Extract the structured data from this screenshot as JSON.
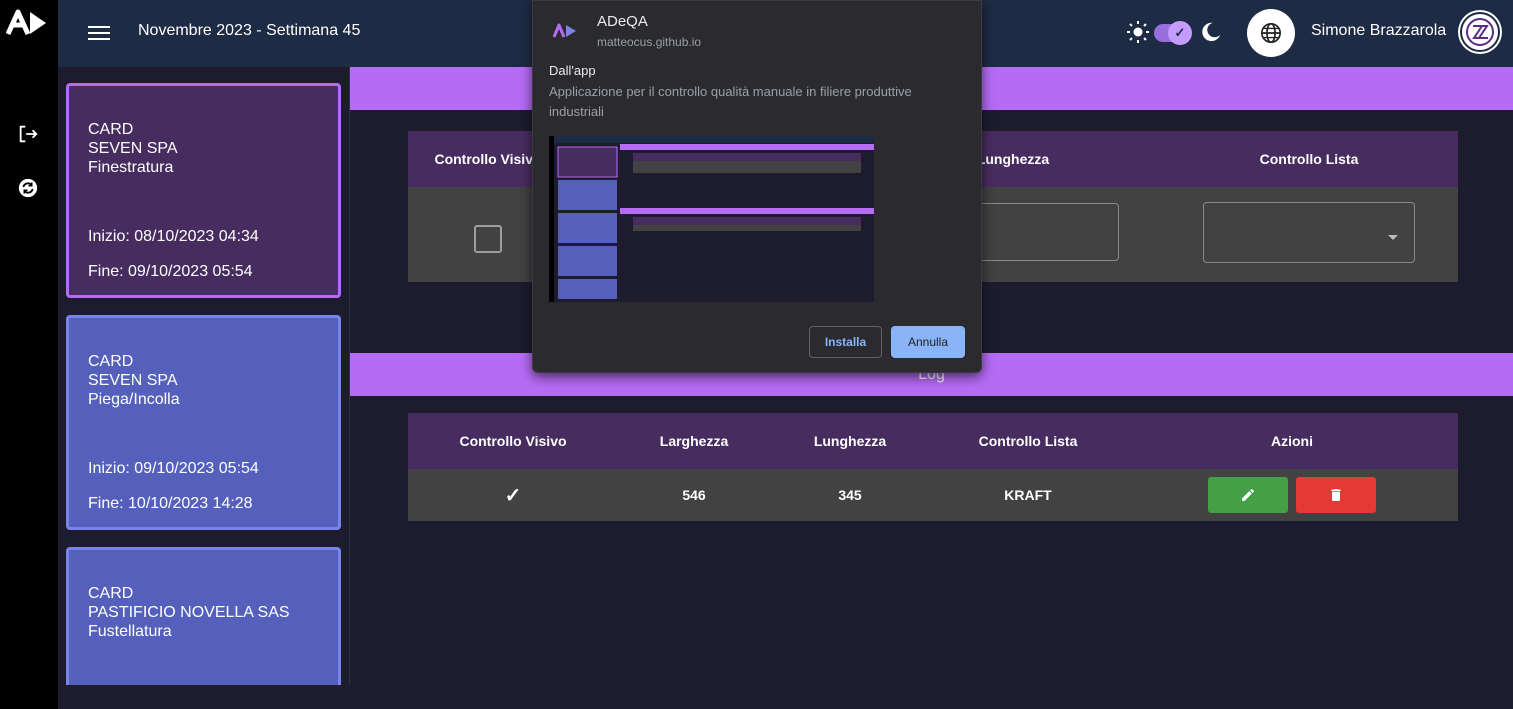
{
  "topbar": {
    "title": "Novembre 2023 - Settimana 45",
    "user_name": "Simone Brazzarola"
  },
  "cards": [
    {
      "line1": "CARD",
      "line2": "SEVEN SPA",
      "line3": "Finestratura",
      "start": "Inizio: 08/10/2023 04:34",
      "end": "Fine: 09/10/2023 05:54",
      "active": true
    },
    {
      "line1": "CARD",
      "line2": "SEVEN SPA",
      "line3": "Piega/Incolla",
      "start": "Inizio: 09/10/2023 05:54",
      "end": "Fine: 10/10/2023 14:28",
      "active": false
    },
    {
      "line1": "CARD",
      "line2": "PASTIFICIO NOVELLA SAS",
      "line3": "Fustellatura",
      "active": false
    }
  ],
  "input_table": {
    "headers": [
      "Controllo Visivo",
      "Lunghezza",
      "Controllo Lista"
    ]
  },
  "log": {
    "title": "Log",
    "headers": [
      "Controllo Visivo",
      "Larghezza",
      "Lunghezza",
      "Controllo Lista",
      "Azioni"
    ],
    "rows": [
      {
        "visivo": "✓",
        "larghezza": "546",
        "lunghezza": "345",
        "lista": "KRAFT"
      }
    ]
  },
  "install_popup": {
    "app_name": "ADeQA",
    "app_url": "matteocus.github.io",
    "from_label": "Dall'app",
    "description": "Applicazione per il controllo qualità manuale in filiere produttive industriali",
    "install_label": "Installa",
    "cancel_label": "Annulla"
  },
  "colors": {
    "accent": "#b66bf5",
    "header": "#1e2b45",
    "card_active": "#472d5f",
    "card": "#5560bd",
    "edit": "#43a047",
    "delete": "#e53935"
  }
}
